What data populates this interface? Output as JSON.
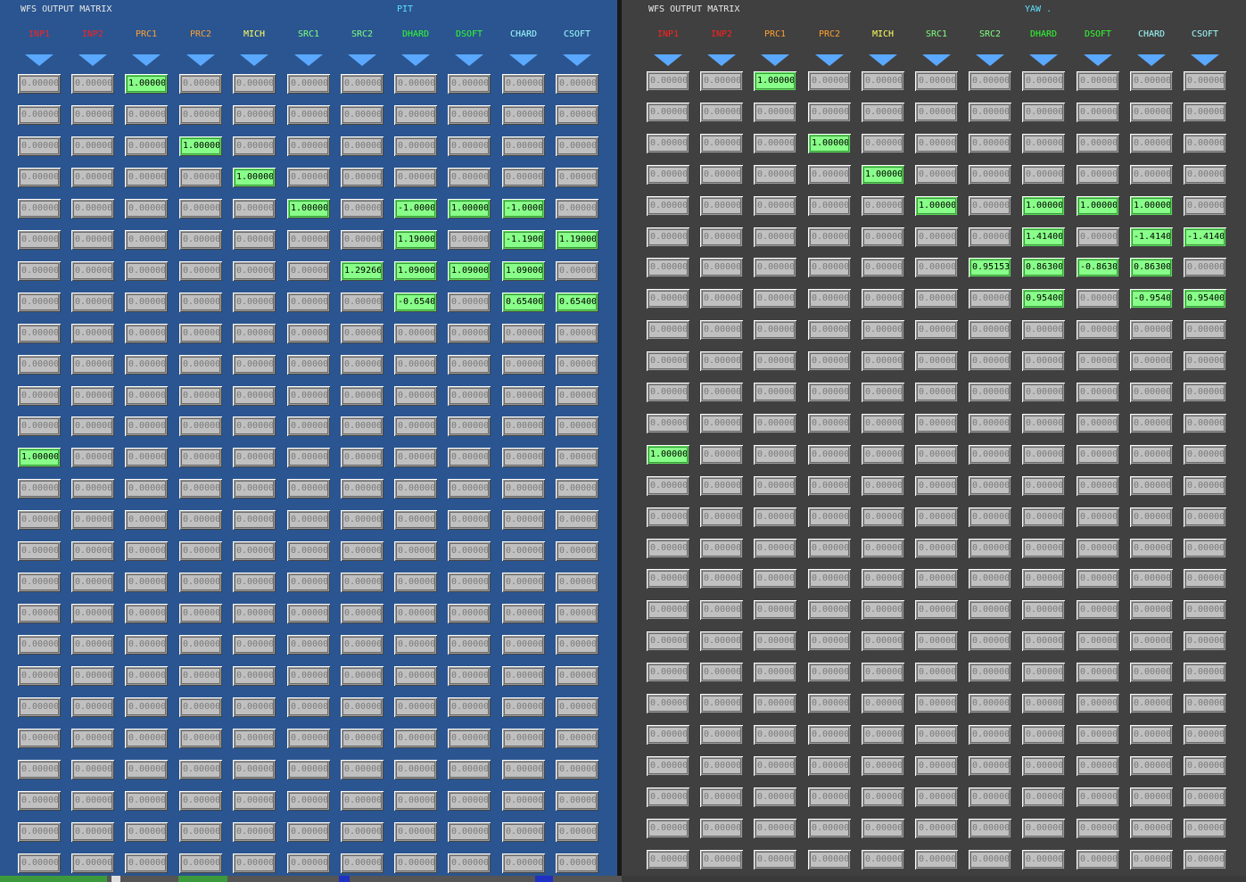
{
  "colors": {
    "pit_bg": "#2a5590",
    "yaw_bg": "#404040",
    "arrow": "#5aa8ff",
    "active_cell": "#88ff88",
    "inactive_cell": "#c0c0c0"
  },
  "columns": [
    {
      "label": "INP1",
      "color": "#ff2020"
    },
    {
      "label": "INP2",
      "color": "#ff2020"
    },
    {
      "label": "PRC1",
      "color": "#ffa030"
    },
    {
      "label": "PRC2",
      "color": "#ffa030"
    },
    {
      "label": "MICH",
      "color": "#ffff60"
    },
    {
      "label": "SRC1",
      "color": "#80ff80"
    },
    {
      "label": "SRC2",
      "color": "#80ff80"
    },
    {
      "label": "DHARD",
      "color": "#30ff30"
    },
    {
      "label": "DSOFT",
      "color": "#30ff30"
    },
    {
      "label": "CHARD",
      "color": "#a0ffff"
    },
    {
      "label": "CSOFT",
      "color": "#a0ffff"
    }
  ],
  "default_value": "0.00000",
  "panels": [
    {
      "id": "pit",
      "title": "WFS OUTPUT MATRIX",
      "subtitle": "PIT",
      "row_count": 26,
      "cells": [
        {
          "r": 0,
          "c": 2,
          "v": "1.00000"
        },
        {
          "r": 2,
          "c": 3,
          "v": "1.00000"
        },
        {
          "r": 3,
          "c": 4,
          "v": "1.00000"
        },
        {
          "r": 4,
          "c": 5,
          "v": "1.00000"
        },
        {
          "r": 4,
          "c": 7,
          "v": "-1.0000"
        },
        {
          "r": 4,
          "c": 8,
          "v": "1.00000"
        },
        {
          "r": 4,
          "c": 9,
          "v": "-1.0000"
        },
        {
          "r": 5,
          "c": 7,
          "v": "1.19000"
        },
        {
          "r": 5,
          "c": 9,
          "v": "-1.1900"
        },
        {
          "r": 5,
          "c": 10,
          "v": "1.19000"
        },
        {
          "r": 6,
          "c": 6,
          "v": "1.29266"
        },
        {
          "r": 6,
          "c": 7,
          "v": "1.09000"
        },
        {
          "r": 6,
          "c": 8,
          "v": "1.09000"
        },
        {
          "r": 6,
          "c": 9,
          "v": "1.09000"
        },
        {
          "r": 7,
          "c": 7,
          "v": "-0.6540"
        },
        {
          "r": 7,
          "c": 9,
          "v": "0.65400"
        },
        {
          "r": 7,
          "c": 10,
          "v": "0.65400"
        },
        {
          "r": 12,
          "c": 0,
          "v": "1.00000"
        }
      ]
    },
    {
      "id": "yaw",
      "title": "WFS OUTPUT MATRIX",
      "subtitle": "YAW .",
      "row_count": 26,
      "cells": [
        {
          "r": 0,
          "c": 2,
          "v": "1.00000"
        },
        {
          "r": 2,
          "c": 3,
          "v": "1.00000"
        },
        {
          "r": 3,
          "c": 4,
          "v": "1.00000"
        },
        {
          "r": 4,
          "c": 5,
          "v": "1.00000"
        },
        {
          "r": 4,
          "c": 7,
          "v": "1.00000"
        },
        {
          "r": 4,
          "c": 8,
          "v": "1.00000"
        },
        {
          "r": 4,
          "c": 9,
          "v": "1.00000"
        },
        {
          "r": 5,
          "c": 7,
          "v": "1.41400"
        },
        {
          "r": 5,
          "c": 9,
          "v": "-1.4140"
        },
        {
          "r": 5,
          "c": 10,
          "v": "-1.4140"
        },
        {
          "r": 6,
          "c": 6,
          "v": "0.95153"
        },
        {
          "r": 6,
          "c": 7,
          "v": "0.86300"
        },
        {
          "r": 6,
          "c": 8,
          "v": "-0.8630"
        },
        {
          "r": 6,
          "c": 9,
          "v": "0.86300"
        },
        {
          "r": 7,
          "c": 7,
          "v": "0.95400"
        },
        {
          "r": 7,
          "c": 9,
          "v": "-0.9540"
        },
        {
          "r": 7,
          "c": 10,
          "v": "0.95400"
        },
        {
          "r": 12,
          "c": 0,
          "v": "1.00000"
        }
      ]
    }
  ]
}
